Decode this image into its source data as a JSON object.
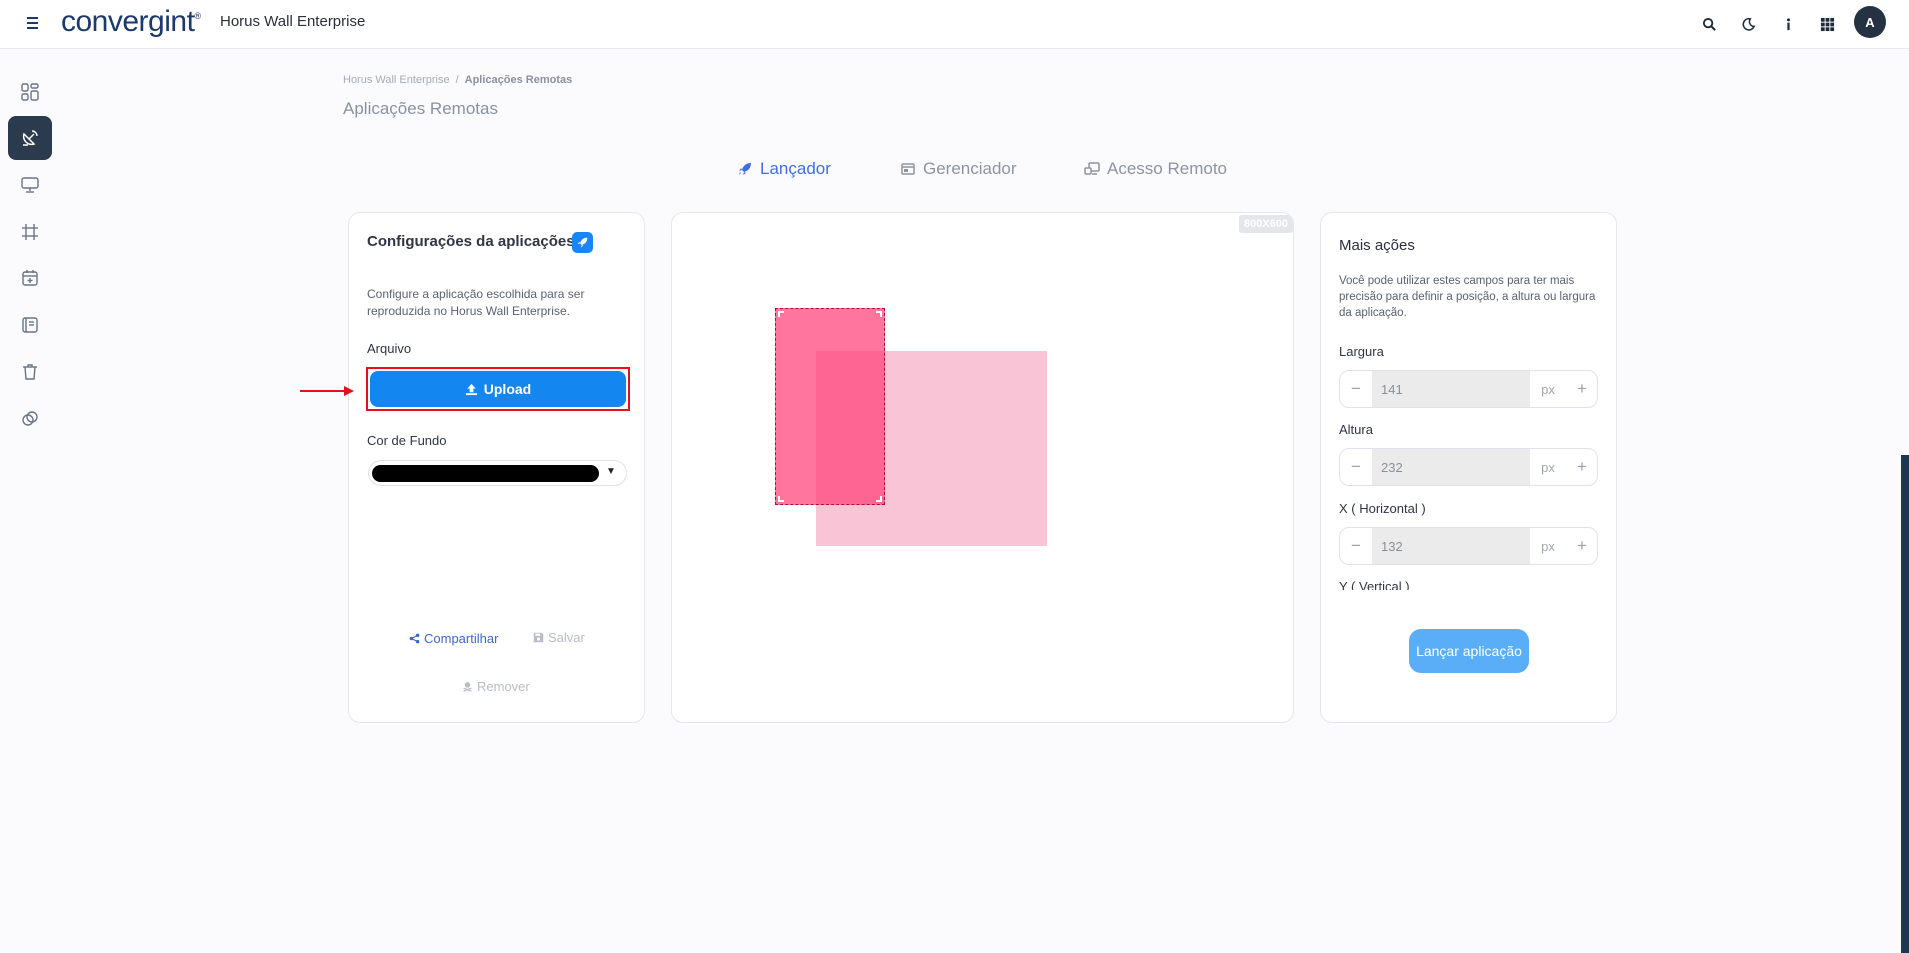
{
  "header": {
    "brand": "convergint",
    "brand_mark": "®",
    "app_title": "Horus Wall Enterprise",
    "avatar_initial": "A"
  },
  "breadcrumb": {
    "root": "Horus Wall Enterprise",
    "separator": "/",
    "current": "Aplicações Remotas"
  },
  "page_title": "Aplicações Remotas",
  "tabs": [
    {
      "label": "Lançador",
      "icon": "rocket-icon",
      "active": true
    },
    {
      "label": "Gerenciador",
      "icon": "window-icon",
      "active": false
    },
    {
      "label": "Acesso Remoto",
      "icon": "remote-desktop-icon",
      "active": false
    }
  ],
  "config": {
    "title": "Configurações da aplicações",
    "description": "Configure a aplicação escolhida para ser reproduzida no Horus Wall Enterprise.",
    "file_label": "Arquivo",
    "upload_label": "Upload",
    "bg_color_label": "Cor de Fundo",
    "bg_color_value": "#000000",
    "share_label": "Compartilhar",
    "save_label": "Salvar",
    "remove_label": "Remover"
  },
  "preview": {
    "resolution": "800X600"
  },
  "actions": {
    "title": "Mais ações",
    "description": "Você pode utilizar estes campos para ter mais precisão para definir a posição, a altura ou largura da aplicação.",
    "fields": [
      {
        "label": "Largura",
        "value": "141",
        "unit": "px"
      },
      {
        "label": "Altura",
        "value": "232",
        "unit": "px"
      },
      {
        "label": "X ( Horizontal )",
        "value": "132",
        "unit": "px"
      },
      {
        "label": "Y ( Vertical )"
      }
    ],
    "launch_label": "Lançar aplicação"
  },
  "colors": {
    "accent": "#1386f0",
    "tab_active": "#3f6ee0",
    "sidebar_active": "#2b3a4c",
    "preview_app": "#ff4078",
    "preview_screen": "#f9c5d6",
    "highlight": "#e3101d"
  }
}
